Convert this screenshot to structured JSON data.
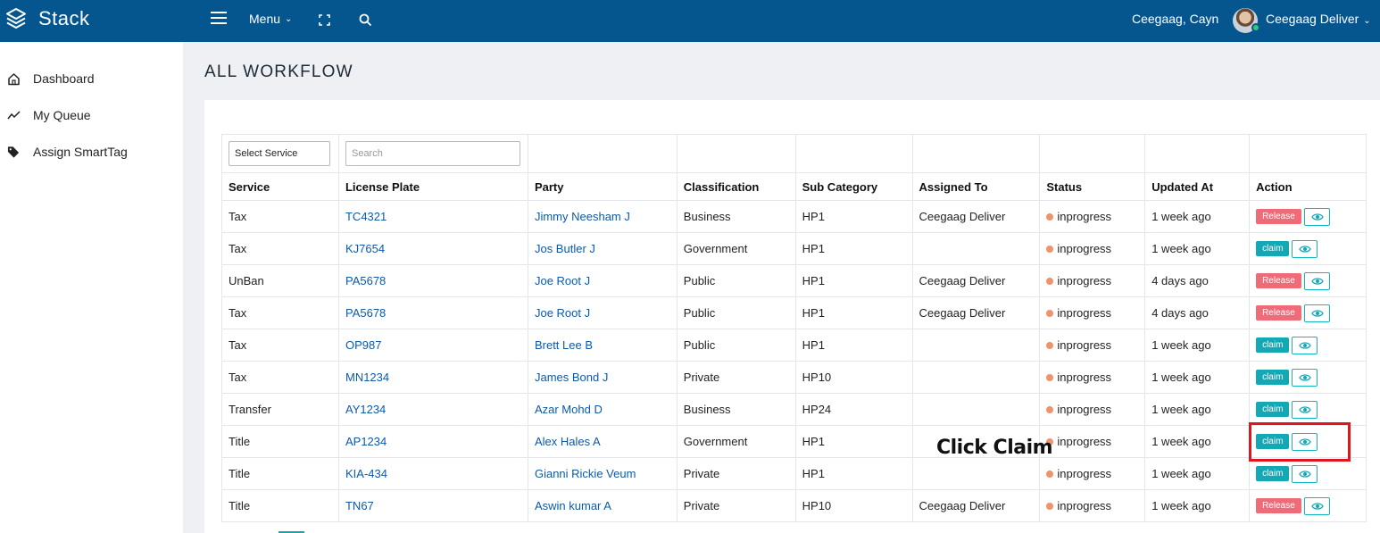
{
  "app": {
    "name": "Stack"
  },
  "topbar": {
    "menu_label": "Menu",
    "user_name": "Ceegaag, Cayn",
    "profile_name": "Ceegaag Deliver"
  },
  "sidebar": {
    "items": [
      {
        "label": "Dashboard",
        "icon": "home-icon"
      },
      {
        "label": "My Queue",
        "icon": "trend-icon"
      },
      {
        "label": "Assign SmartTag",
        "icon": "tag-icon"
      }
    ]
  },
  "page": {
    "title": "ALL WORKFLOW"
  },
  "filters": {
    "service_select": "Select Service",
    "search_placeholder": "Search"
  },
  "table": {
    "columns": [
      "Service",
      "License Plate",
      "Party",
      "Classification",
      "Sub Category",
      "Assigned To",
      "Status",
      "Updated At",
      "Action"
    ],
    "rows": [
      {
        "service": "Tax",
        "plate": "TC4321",
        "party": "Jimmy Neesham J",
        "classification": "Business",
        "sub_category": "HP1",
        "assigned_to": "Ceegaag Deliver",
        "status": "inprogress",
        "updated": "1 week ago",
        "action": "Release"
      },
      {
        "service": "Tax",
        "plate": "KJ7654",
        "party": "Jos Butler J",
        "classification": "Government",
        "sub_category": "HP1",
        "assigned_to": "",
        "status": "inprogress",
        "updated": "1 week ago",
        "action": "claim"
      },
      {
        "service": "UnBan",
        "plate": "PA5678",
        "party": "Joe Root J",
        "classification": "Public",
        "sub_category": "HP1",
        "assigned_to": "Ceegaag Deliver",
        "status": "inprogress",
        "updated": "4 days ago",
        "action": "Release"
      },
      {
        "service": "Tax",
        "plate": "PA5678",
        "party": "Joe Root J",
        "classification": "Public",
        "sub_category": "HP1",
        "assigned_to": "Ceegaag Deliver",
        "status": "inprogress",
        "updated": "4 days ago",
        "action": "Release"
      },
      {
        "service": "Tax",
        "plate": "OP987",
        "party": "Brett Lee B",
        "classification": "Public",
        "sub_category": "HP1",
        "assigned_to": "",
        "status": "inprogress",
        "updated": "1 week ago",
        "action": "claim"
      },
      {
        "service": "Tax",
        "plate": "MN1234",
        "party": "James Bond J",
        "classification": "Private",
        "sub_category": "HP10",
        "assigned_to": "",
        "status": "inprogress",
        "updated": "1 week ago",
        "action": "claim"
      },
      {
        "service": "Transfer",
        "plate": "AY1234",
        "party": "Azar Mohd D",
        "classification": "Business",
        "sub_category": "HP24",
        "assigned_to": "",
        "status": "inprogress",
        "updated": "1 week ago",
        "action": "claim"
      },
      {
        "service": "Title",
        "plate": "AP1234",
        "party": "Alex Hales A",
        "classification": "Government",
        "sub_category": "HP1",
        "assigned_to": "",
        "status": "inprogress",
        "updated": "1 week ago",
        "action": "claim"
      },
      {
        "service": "Title",
        "plate": "KIA-434",
        "party": "Gianni Rickie Veum",
        "classification": "Private",
        "sub_category": "HP1",
        "assigned_to": "",
        "status": "inprogress",
        "updated": "1 week ago",
        "action": "claim"
      },
      {
        "service": "Title",
        "plate": "TN67",
        "party": "Aswin kumar A",
        "classification": "Private",
        "sub_category": "HP10",
        "assigned_to": "Ceegaag Deliver",
        "status": "inprogress",
        "updated": "1 week ago",
        "action": "Release"
      }
    ]
  },
  "annotation": {
    "text": "Click Claim"
  },
  "colors": {
    "topbar": "#05568f",
    "release": "#f06b78",
    "claim": "#12a8b5",
    "status_dot": "#f0936a",
    "highlight": "#e0161e"
  },
  "icons": {
    "logo": "stack-logo-icon",
    "hamburger": "hamburger-icon",
    "fullscreen": "fullscreen-icon",
    "search": "search-icon",
    "view": "eye-icon"
  }
}
